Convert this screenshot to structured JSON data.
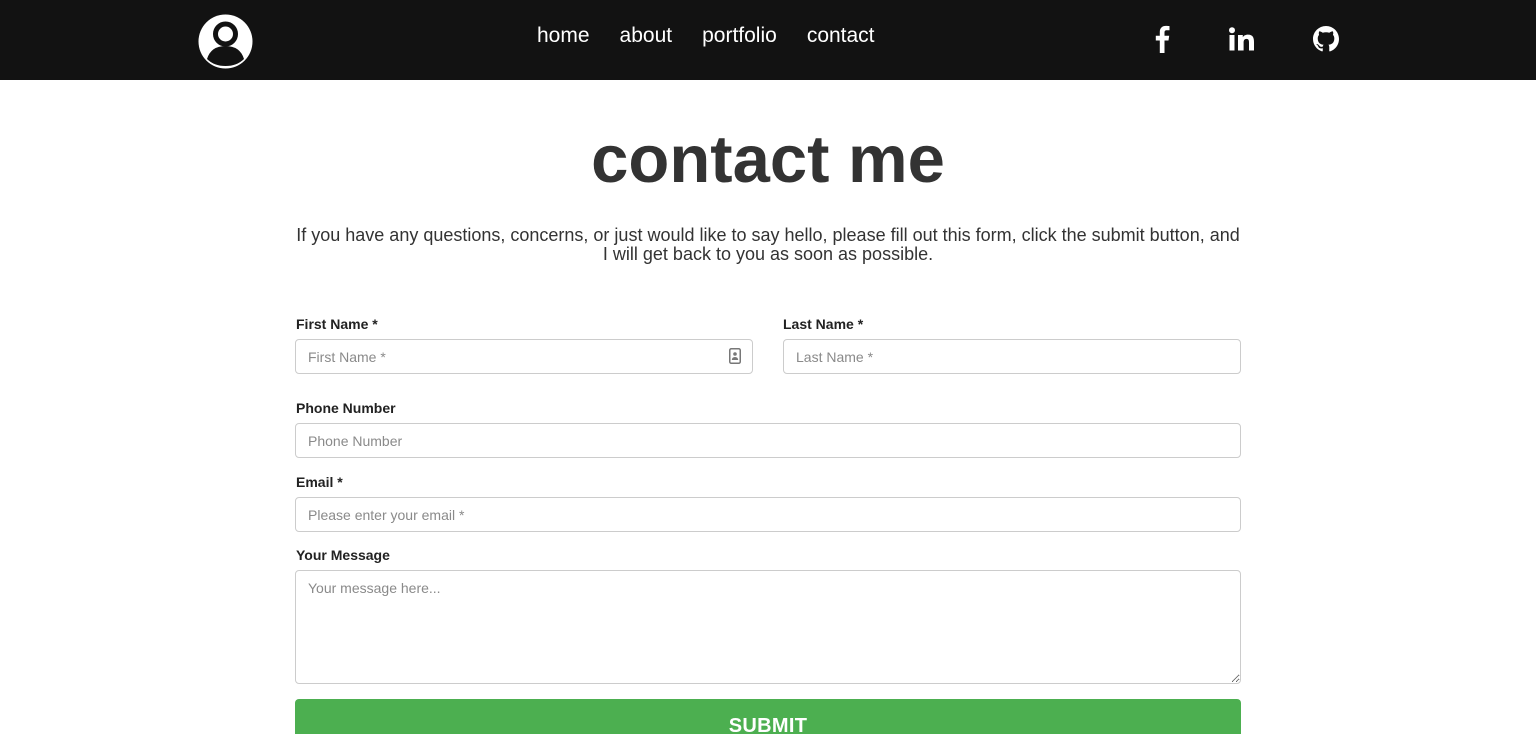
{
  "nav": {
    "links": [
      "home",
      "about",
      "portfolio",
      "contact"
    ],
    "social": [
      "facebook-icon",
      "linkedin-icon",
      "github-icon"
    ]
  },
  "heading": "contact me",
  "intro": "If you have any questions, concerns, or just would like to say hello, please fill out this form, click the submit button, and I will get back to you as soon as possible.",
  "form": {
    "first_name": {
      "label": "First Name *",
      "placeholder": "First Name *",
      "value": ""
    },
    "last_name": {
      "label": "Last Name *",
      "placeholder": "Last Name *",
      "value": ""
    },
    "phone": {
      "label": "Phone Number",
      "placeholder": "Phone Number",
      "value": ""
    },
    "email": {
      "label": "Email *",
      "placeholder": "Please enter your email *",
      "value": ""
    },
    "message": {
      "label": "Your Message",
      "placeholder": "Your message here...",
      "value": ""
    },
    "submit_label": "SUBMIT"
  },
  "colors": {
    "navbar": "#121212",
    "submit": "#4caf50",
    "text": "#333333"
  }
}
